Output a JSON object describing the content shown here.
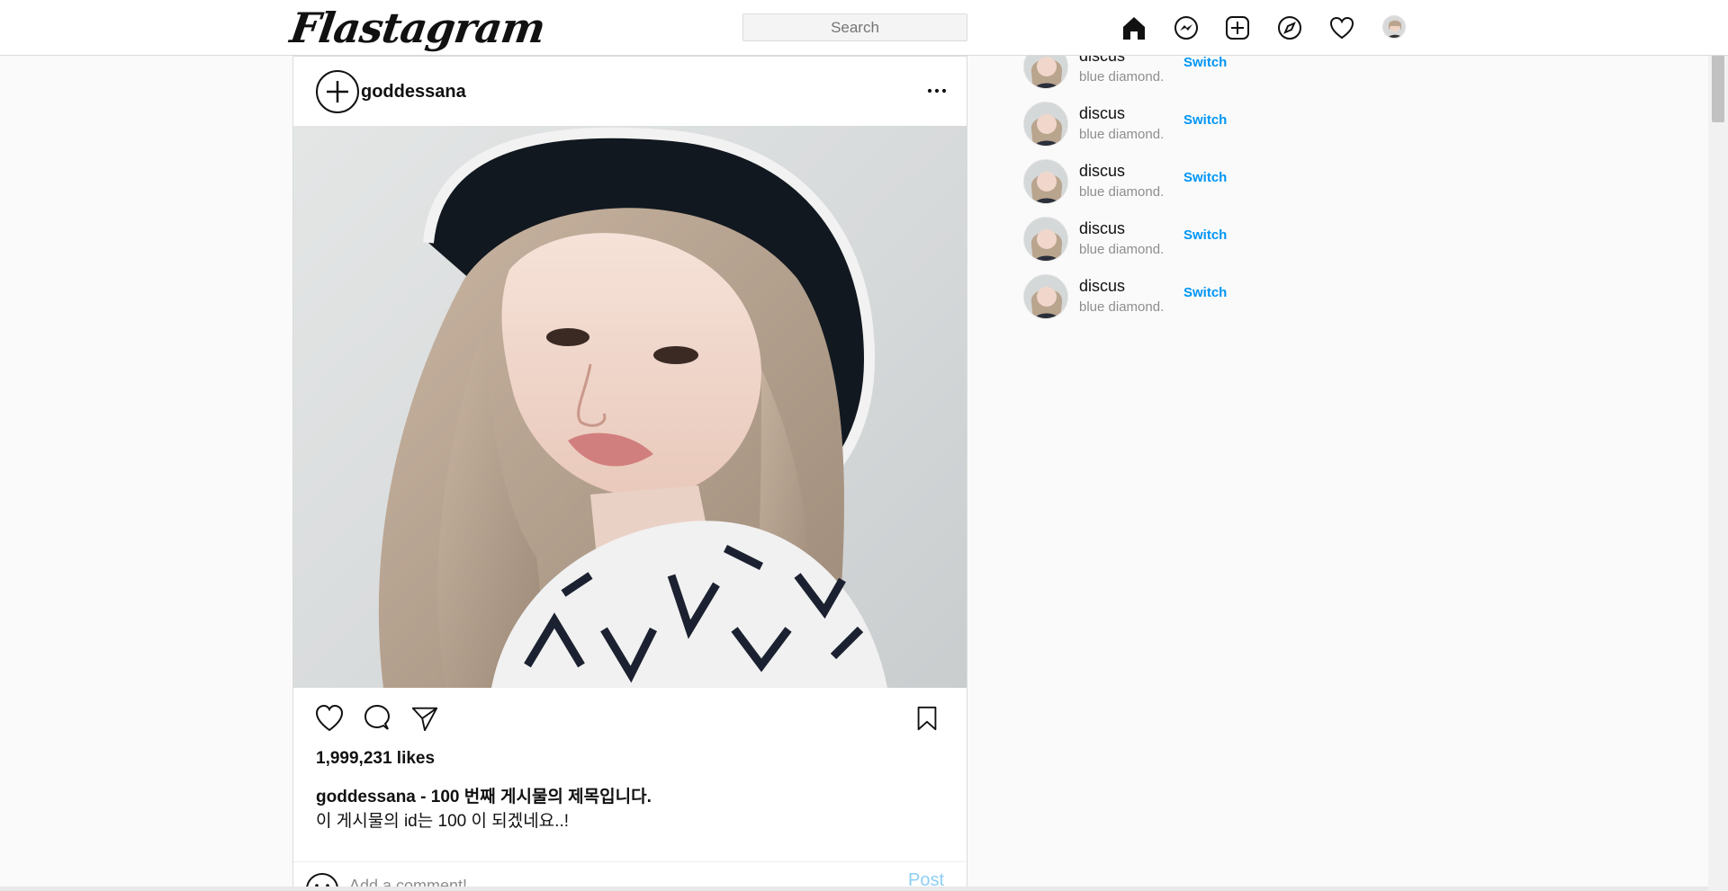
{
  "app": {
    "logo": "Flastagram"
  },
  "header": {
    "search_placeholder": "Search",
    "nav_icons": [
      "home-icon",
      "messenger-icon",
      "new-post-icon",
      "explore-icon",
      "activity-heart-icon",
      "profile-avatar"
    ]
  },
  "post": {
    "username": "goddessana",
    "likes": "1,999,231 likes",
    "caption_user": "goddessana",
    "caption_title": " - 100 번째 게시물의 제목입니다.",
    "caption_body": "이 게시물의 id는 100 이 되겠네요..!",
    "comment_placeholder": "Add a comment!",
    "post_button": "Post"
  },
  "suggestions": [
    {
      "name": "discus",
      "subtitle": "blue diamond.",
      "action": "Switch"
    },
    {
      "name": "discus",
      "subtitle": "blue diamond.",
      "action": "Switch"
    },
    {
      "name": "discus",
      "subtitle": "blue diamond.",
      "action": "Switch"
    },
    {
      "name": "discus",
      "subtitle": "blue diamond.",
      "action": "Switch"
    },
    {
      "name": "discus",
      "subtitle": "blue diamond.",
      "action": "Switch"
    }
  ],
  "colors": {
    "accent": "#0095f6",
    "post_button": "#8fcff5",
    "border": "#dbdbdb",
    "background": "#fafafa"
  }
}
